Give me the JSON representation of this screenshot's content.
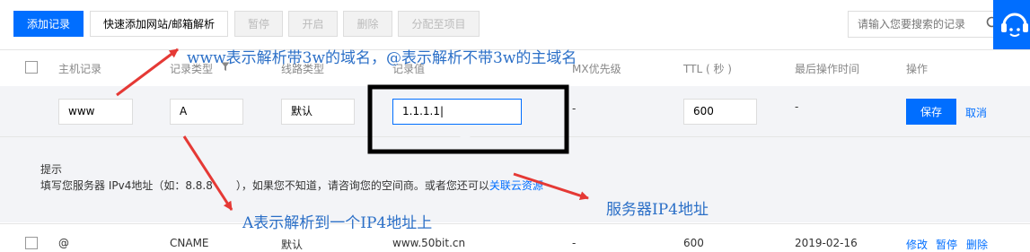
{
  "toolbar": {
    "add_record": "添加记录",
    "quick_add": "快速添加网站/邮箱解析",
    "pause": "暂停",
    "enable": "开启",
    "delete": "删除",
    "assign_project": "分配至项目",
    "search_placeholder": "请输入您要搜索的记录"
  },
  "table": {
    "headers": {
      "host": "主机记录",
      "type": "记录类型",
      "line": "线路类型",
      "value": "记录值",
      "mx": "MX优先级",
      "ttl": "TTL ( 秒 )",
      "last_op": "最后操作时间",
      "actions": "操作"
    },
    "edit_row": {
      "host": "www",
      "type": "A",
      "line": "默认",
      "value": "1.1.1.1",
      "mx": "-",
      "ttl": "600",
      "last_op": "-",
      "save": "保存",
      "cancel": "取消"
    },
    "tip": {
      "title": "提示",
      "text_before": "填写您服务器 IPv4地址（如：8.8.8",
      "text_after": "），如果您不知道，请咨询您的空间商。或者您还可以",
      "link": "关联云资源"
    },
    "row2": {
      "host": "@",
      "type": "CNAME",
      "line": "默认",
      "value": "www.50bit.cn",
      "mx": "-",
      "ttl": "600",
      "last_op": "2019-02-16",
      "edit": "修改",
      "pause": "暂停",
      "delete": "删除"
    }
  },
  "annotations": {
    "host_note": "www表示解析带3w的域名，@表示解析不带3w的主域名",
    "type_note": "A表示解析到一个IP4地址上",
    "value_note": "服务器IP4地址"
  },
  "colors": {
    "primary": "#006eff",
    "annotation_arrow": "#e53935",
    "annotation_text": "#2b6fc7"
  }
}
